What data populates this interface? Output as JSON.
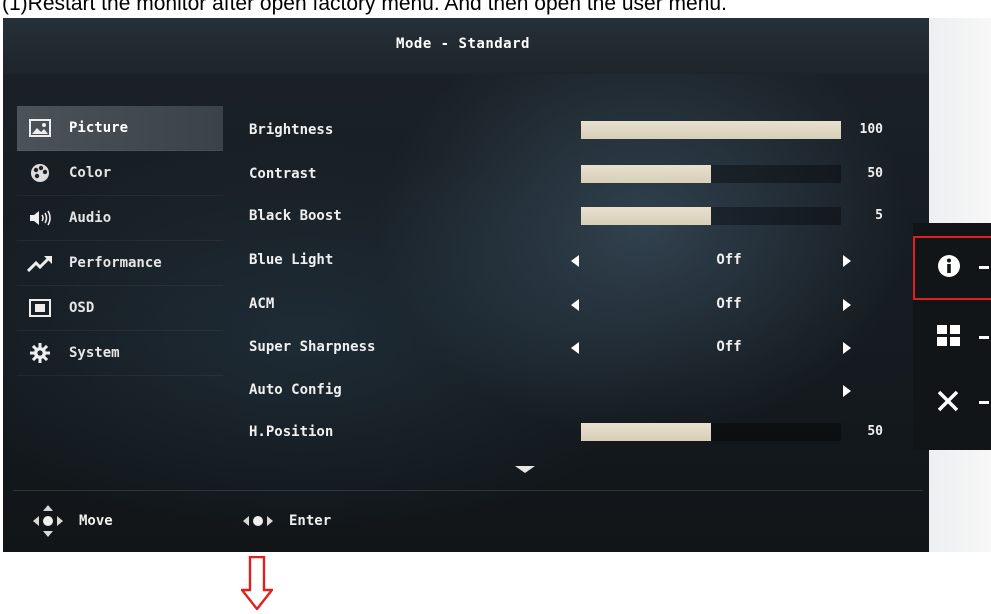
{
  "caption": "(1)Restart the monitor after open factory menu. And then open the user menu.",
  "osd": {
    "mode_title": "Mode - Standard",
    "sidebar": [
      {
        "label": "Picture",
        "icon": "picture-icon",
        "active": true
      },
      {
        "label": "Color",
        "icon": "palette-icon",
        "active": false
      },
      {
        "label": "Audio",
        "icon": "speaker-icon",
        "active": false
      },
      {
        "label": "Performance",
        "icon": "trend-arrow-icon",
        "active": false
      },
      {
        "label": "OSD",
        "icon": "osd-screen-icon",
        "active": false
      },
      {
        "label": "System",
        "icon": "gear-icon",
        "active": false
      }
    ],
    "settings": [
      {
        "label": "Brightness",
        "type": "slider",
        "value": "100",
        "level": 1.0
      },
      {
        "label": "Contrast",
        "type": "slider",
        "value": "50",
        "level": 0.5
      },
      {
        "label": "Black Boost",
        "type": "slider",
        "value": "5",
        "level": 0.5
      },
      {
        "label": "Blue Light",
        "type": "option",
        "value": "Off"
      },
      {
        "label": "ACM",
        "type": "option",
        "value": "Off"
      },
      {
        "label": "Super Sharpness",
        "type": "option",
        "value": "Off"
      },
      {
        "label": "Auto Config",
        "type": "action"
      },
      {
        "label": "H.Position",
        "type": "slider",
        "value": "50",
        "level": 0.5
      }
    ],
    "footer": {
      "move_label": "Move",
      "enter_label": "Enter"
    }
  },
  "hotkeys": [
    {
      "icon": "info-icon",
      "highlighted": true
    },
    {
      "icon": "grid-menu-icon",
      "highlighted": false
    },
    {
      "icon": "close-icon",
      "highlighted": false
    }
  ],
  "colors": {
    "highlight_box": "#e0201c",
    "slider_fill": "#e0d8c3",
    "arrow": "#e0201c"
  }
}
